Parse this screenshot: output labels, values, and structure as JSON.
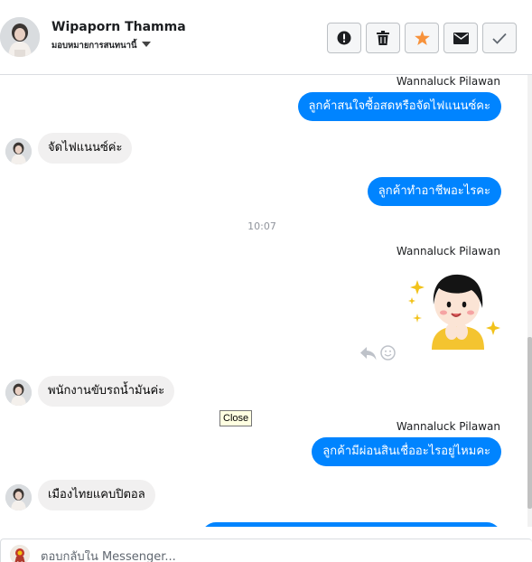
{
  "header": {
    "name": "Wipaporn Thamma",
    "status": "มอบหมายการสนทนานี้",
    "actions": [
      {
        "icon": "alert-icon"
      },
      {
        "icon": "trash-icon"
      },
      {
        "icon": "star-icon"
      },
      {
        "icon": "envelope-icon"
      },
      {
        "icon": "check-icon"
      }
    ]
  },
  "messages": [
    {
      "sender": "Wannaluck Pilawan",
      "text": "ลูกค้าสนใจซื้อสดหรือจัดไฟแนนซ์คะ"
    },
    {
      "text": "จัดไฟแนนซ์ค่ะ"
    },
    {
      "text": "ลูกค้าทำอาชีพอะไรคะ"
    },
    {
      "time": "10:07"
    },
    {
      "sender": "Wannaluck Pilawan",
      "sticker": "girl-sparkle-sticker"
    },
    {
      "text": "พนักงานขับรถน้ำมันค่ะ"
    },
    {
      "sender": "Wannaluck Pilawan",
      "text": "ลูกค้ามีผ่อนสินเชื่ออะไรอยู่ไหมคะ"
    },
    {
      "text": "เมืองไทยแคบปิตอล"
    }
  ],
  "tooltip": "Close",
  "composer": {
    "placeholder": "ตอบกลับใน Messenger..."
  },
  "colors": {
    "outgoing_bubble": "#0084ff",
    "incoming_bubble": "#f1f0f0",
    "star": "#f7923b"
  }
}
